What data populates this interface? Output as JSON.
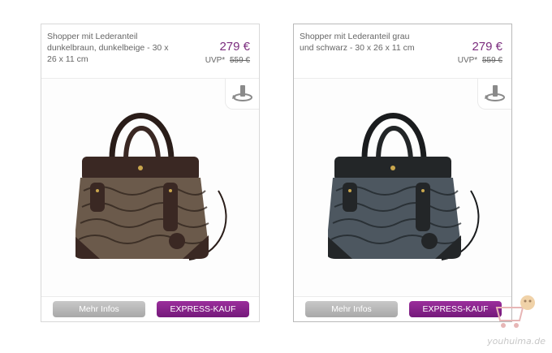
{
  "products": [
    {
      "title": "Shopper mit Lederanteil dunkelbraun, dunkelbeige - 30 x 26 x 11 cm",
      "price": "279 €",
      "uvp_label": "UVP*",
      "uvp_price": "559 €",
      "info_label": "Mehr Infos",
      "express_label": "EXPRESS-KAUF",
      "bag_colors": {
        "body": "#6b5a4b",
        "leather": "#3a2823",
        "pattern": "#2a1f19"
      }
    },
    {
      "title": "Shopper mit Lederanteil grau und schwarz - 30 x 26 x 11 cm",
      "price": "279 €",
      "uvp_label": "UVP*",
      "uvp_price": "559 €",
      "info_label": "Mehr Infos",
      "express_label": "EXPRESS-KAUF",
      "bag_colors": {
        "body": "#4d5760",
        "leather": "#232628",
        "pattern": "#1c2125"
      }
    }
  ],
  "watermark": "youhuima.de",
  "colors": {
    "accent": "#7b2d7e",
    "button_gray": "#b4b4b4"
  }
}
